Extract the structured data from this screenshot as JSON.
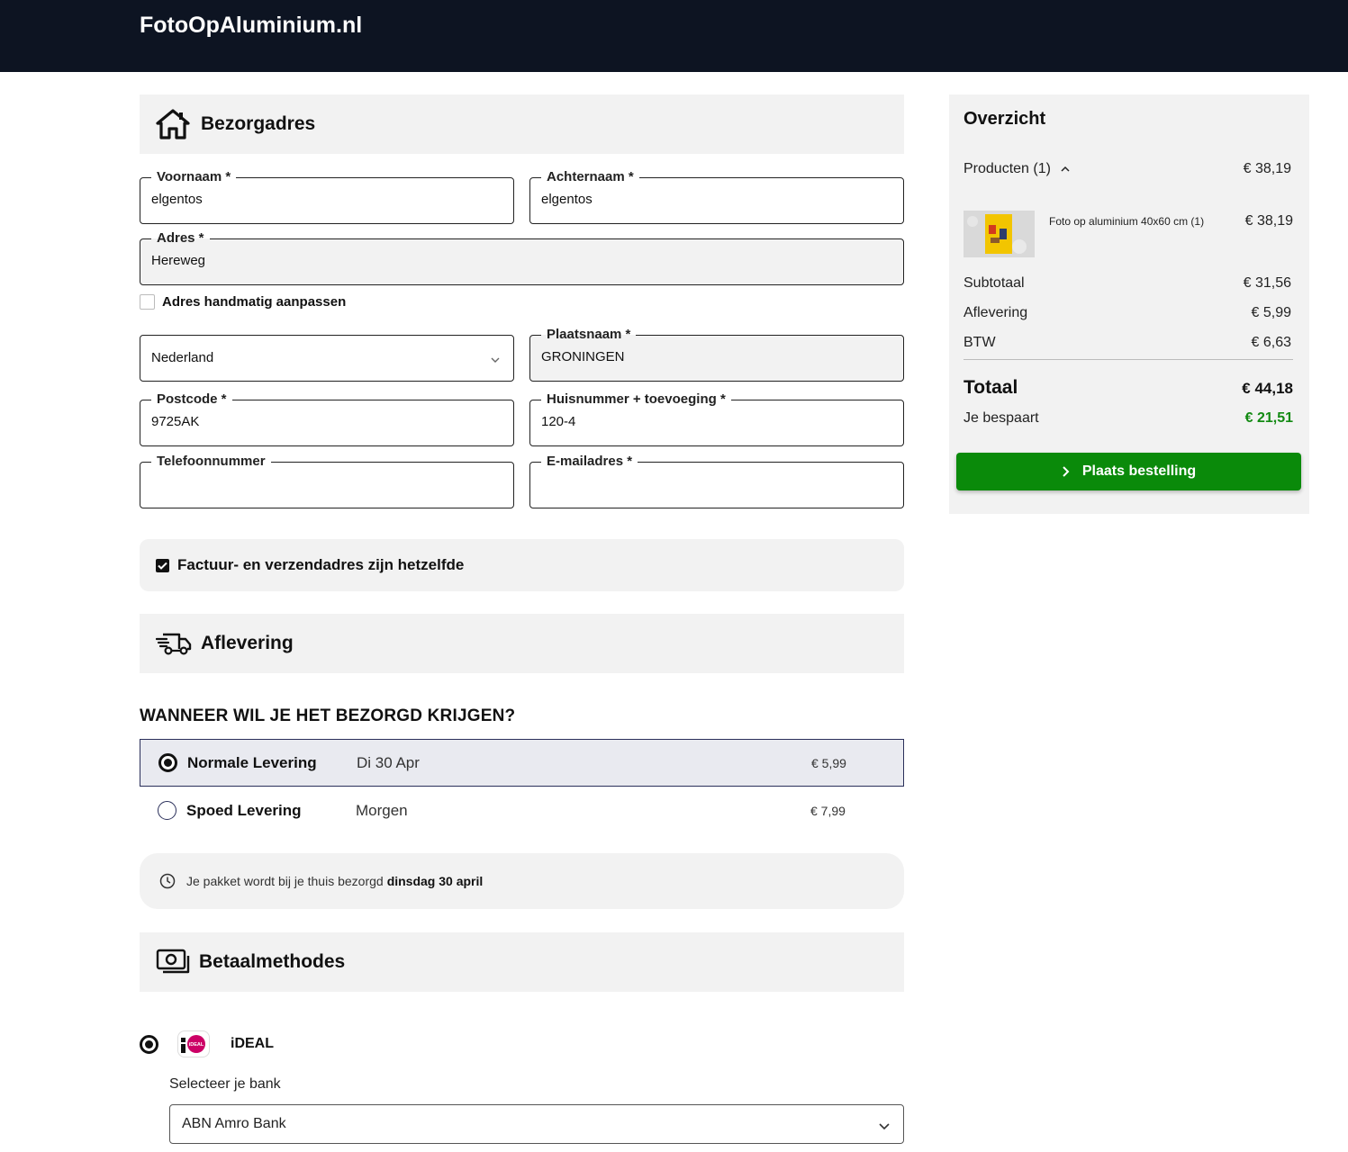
{
  "brand": {
    "logo_text": "FotoOpAluminium.nl"
  },
  "address": {
    "title": "Bezorgadres",
    "firstname": {
      "label": "Voornaam *",
      "value": "elgentos"
    },
    "lastname": {
      "label": "Achternaam *",
      "value": "elgentos"
    },
    "street": {
      "label": "Adres *",
      "value": "Hereweg"
    },
    "manual_label": "Adres handmatig aanpassen",
    "country": {
      "value": "Nederland"
    },
    "city": {
      "label": "Plaatsnaam *",
      "value": "GRONINGEN"
    },
    "postcode": {
      "label": "Postcode *",
      "value": "9725AK"
    },
    "housenumber": {
      "label": "Huisnummer + toevoeging *",
      "value": "120-4"
    },
    "phone": {
      "label": "Telefoonnummer",
      "value": ""
    },
    "email": {
      "label": "E-mailadres *",
      "value": ""
    },
    "same_address_label": "Factuur- en verzendadres zijn hetzelfde"
  },
  "delivery": {
    "title": "Aflevering",
    "question": "WANNEER WIL JE HET BEZORGD KRIJGEN?",
    "options": [
      {
        "name": "Normale Levering",
        "date": "Di 30 Apr",
        "price": "€ 5,99",
        "selected": true
      },
      {
        "name": "Spoed Levering",
        "date": "Morgen",
        "price": "€ 7,99",
        "selected": false
      }
    ],
    "info_text": "Je pakket wordt bij je thuis bezorgd",
    "info_bold": "dinsdag 30 april"
  },
  "payment": {
    "title": "Betaalmethodes",
    "method_name": "iDEAL",
    "logo_text": "iDEAL",
    "bank_label": "Selecteer je bank",
    "bank_value": "ABN Amro Bank"
  },
  "summary": {
    "title": "Overzicht",
    "products_label": "Producten (1)",
    "products_total": "€ 38,19",
    "product_name": "Foto op aluminium 40x60 cm (1)",
    "product_price": "€ 38,19",
    "subtotal_label": "Subtotaal",
    "subtotal_value": "€ 31,56",
    "delivery_label": "Aflevering",
    "delivery_value": "€ 5,99",
    "tax_label": "BTW",
    "tax_value": "€ 6,63",
    "total_label": "Totaal",
    "total_value": "€ 44,18",
    "savings_label": "Je bespaart",
    "savings_value": "€ 21,51",
    "order_button": "Plaats bestelling",
    "accent_color": "#0a8a0a"
  }
}
